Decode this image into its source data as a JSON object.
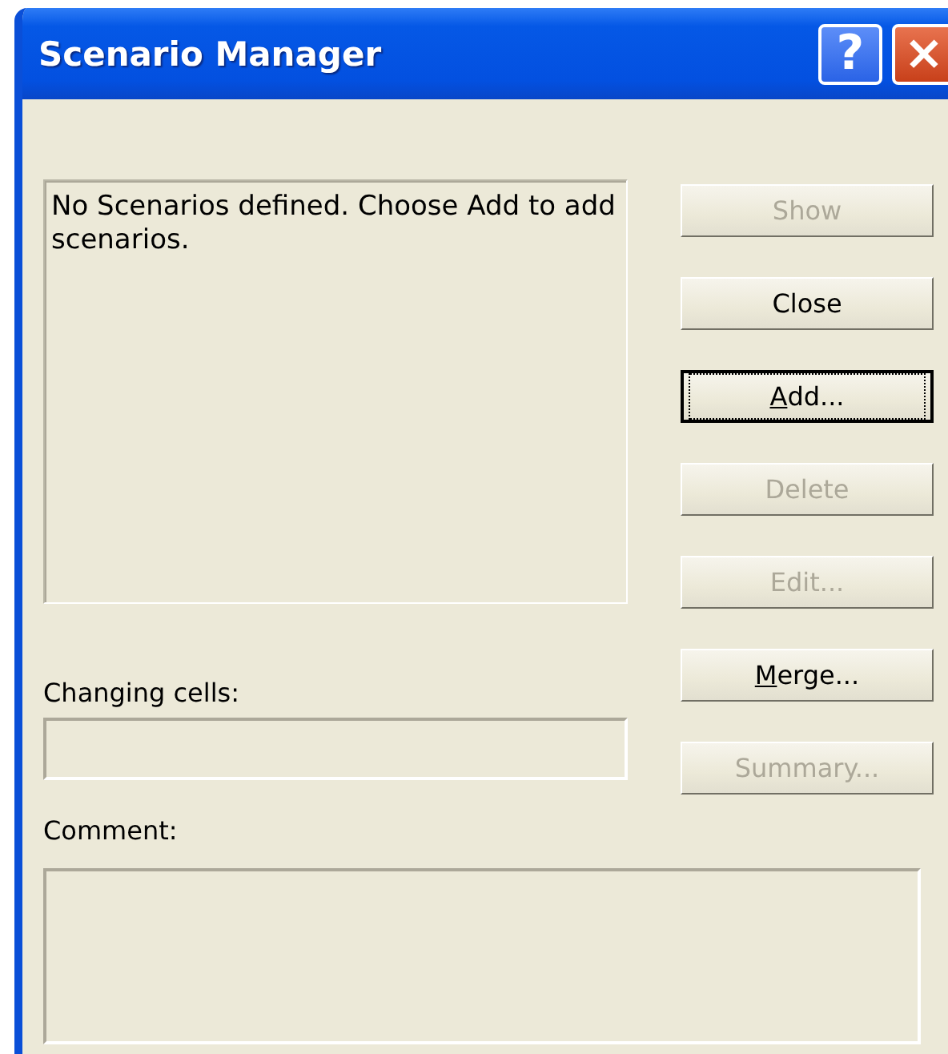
{
  "window": {
    "title": "Scenario Manager",
    "help_button": "?",
    "close_button": "×"
  },
  "scenarios_list": {
    "message": "No Scenarios defined. Choose Add to add scenarios."
  },
  "buttons": [
    {
      "before": "Show",
      "disabled": true,
      "focused": false
    },
    {
      "before": "Close",
      "disabled": false,
      "focused": false
    },
    {
      "key": "A",
      "after": "dd...",
      "disabled": false,
      "focused": true
    },
    {
      "before": "Delete",
      "disabled": true,
      "focused": false
    },
    {
      "before": "Edit...",
      "disabled": true,
      "focused": false
    },
    {
      "key": "M",
      "after": "erge...",
      "disabled": false,
      "focused": false
    },
    {
      "before": "Summary...",
      "disabled": true,
      "focused": false
    }
  ],
  "changing_cells": {
    "label": "Changing cells:"
  },
  "comment": {
    "label": "Comment:"
  }
}
